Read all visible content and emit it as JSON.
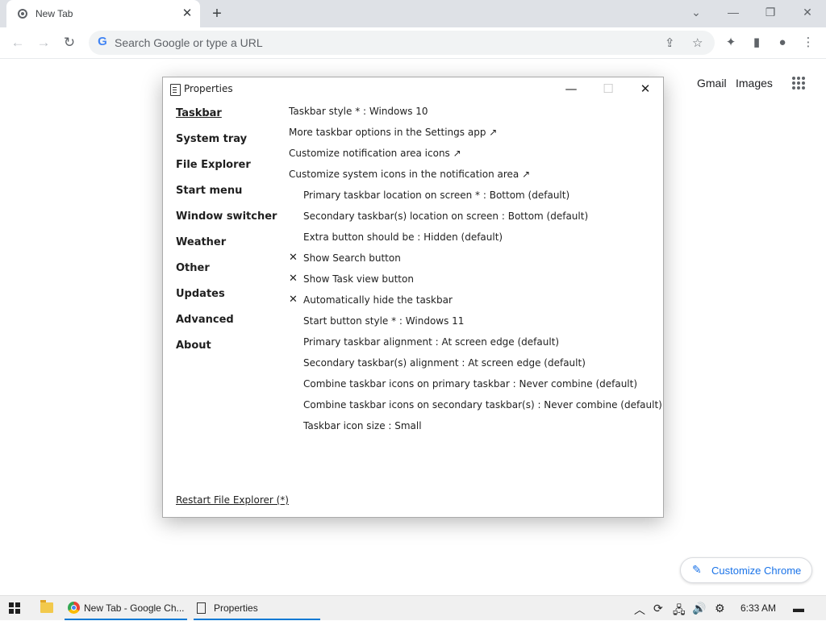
{
  "browser": {
    "tab": {
      "title": "New Tab",
      "favicon": "chrome-icon",
      "close_glyph": "✕"
    },
    "new_tab_glyph": "+",
    "window_controls": {
      "tab_search": "⌄",
      "minimize": "—",
      "restore": "❐",
      "close": "✕"
    },
    "toolbar": {
      "back": "←",
      "forward": "→",
      "reload": "↻",
      "omnibox_placeholder": "Search Google or type a URL",
      "google_g": "G",
      "share_glyph": "⇪",
      "bookmark_glyph": "☆",
      "extensions_glyph": "✦",
      "sidepanel_glyph": "▮",
      "profile_glyph": "●",
      "menu_glyph": "⋮"
    },
    "page": {
      "gmail": "Gmail",
      "images": "Images",
      "customize": {
        "icon": "✎",
        "label": "Customize Chrome",
        "accent": "#1a73e8"
      }
    }
  },
  "dialog": {
    "title": "Properties",
    "controls": {
      "minimize": "—",
      "maximize": "☐",
      "close": "✕"
    },
    "nav": [
      {
        "label": "Taskbar",
        "active": true
      },
      {
        "label": "System tray"
      },
      {
        "label": "File Explorer"
      },
      {
        "label": "Start menu"
      },
      {
        "label": "Window switcher"
      },
      {
        "label": "Weather"
      },
      {
        "label": "Other"
      },
      {
        "label": "Updates"
      },
      {
        "label": "Advanced"
      },
      {
        "label": "About"
      }
    ],
    "options": [
      {
        "label": "Taskbar style * : Windows 10"
      },
      {
        "label": "More taskbar options in the Settings app ↗"
      },
      {
        "label": "Customize notification area icons ↗"
      },
      {
        "label": "Customize system icons in the notification area ↗"
      },
      {
        "label": "Primary taskbar location on screen * : Bottom (default)"
      },
      {
        "label": "Secondary taskbar(s) location on screen : Bottom (default)"
      },
      {
        "label": "Extra button should be : Hidden (default)"
      },
      {
        "label": "Show Search button",
        "checked": true
      },
      {
        "label": "Show Task view button",
        "checked": true
      },
      {
        "label": "Automatically hide the taskbar",
        "checked": true
      },
      {
        "label": "Start button style * : Windows 11"
      },
      {
        "label": "Primary taskbar alignment : At screen edge (default)"
      },
      {
        "label": "Secondary taskbar(s) alignment : At screen edge (default)"
      },
      {
        "label": "Combine taskbar icons on primary taskbar : Never combine (default)"
      },
      {
        "label": "Combine taskbar icons on secondary taskbar(s) : Never combine (default)"
      },
      {
        "label": "Taskbar icon size : Small"
      }
    ],
    "check_glyph": "✕",
    "restart_link": "Restart File Explorer (*)"
  },
  "taskbar": {
    "items": [
      {
        "label": "New Tab - Google Ch...",
        "icon": "chrome-icon",
        "active": true
      },
      {
        "label": "Properties",
        "icon": "properties-icon",
        "active": true
      }
    ],
    "tray": {
      "chevron": "︿",
      "update": "⟳",
      "network": "🖧",
      "volume": "🔊",
      "settings": "⚙",
      "notifications": "▬"
    },
    "clock": "6:33 AM",
    "accent": "#0078d4"
  }
}
